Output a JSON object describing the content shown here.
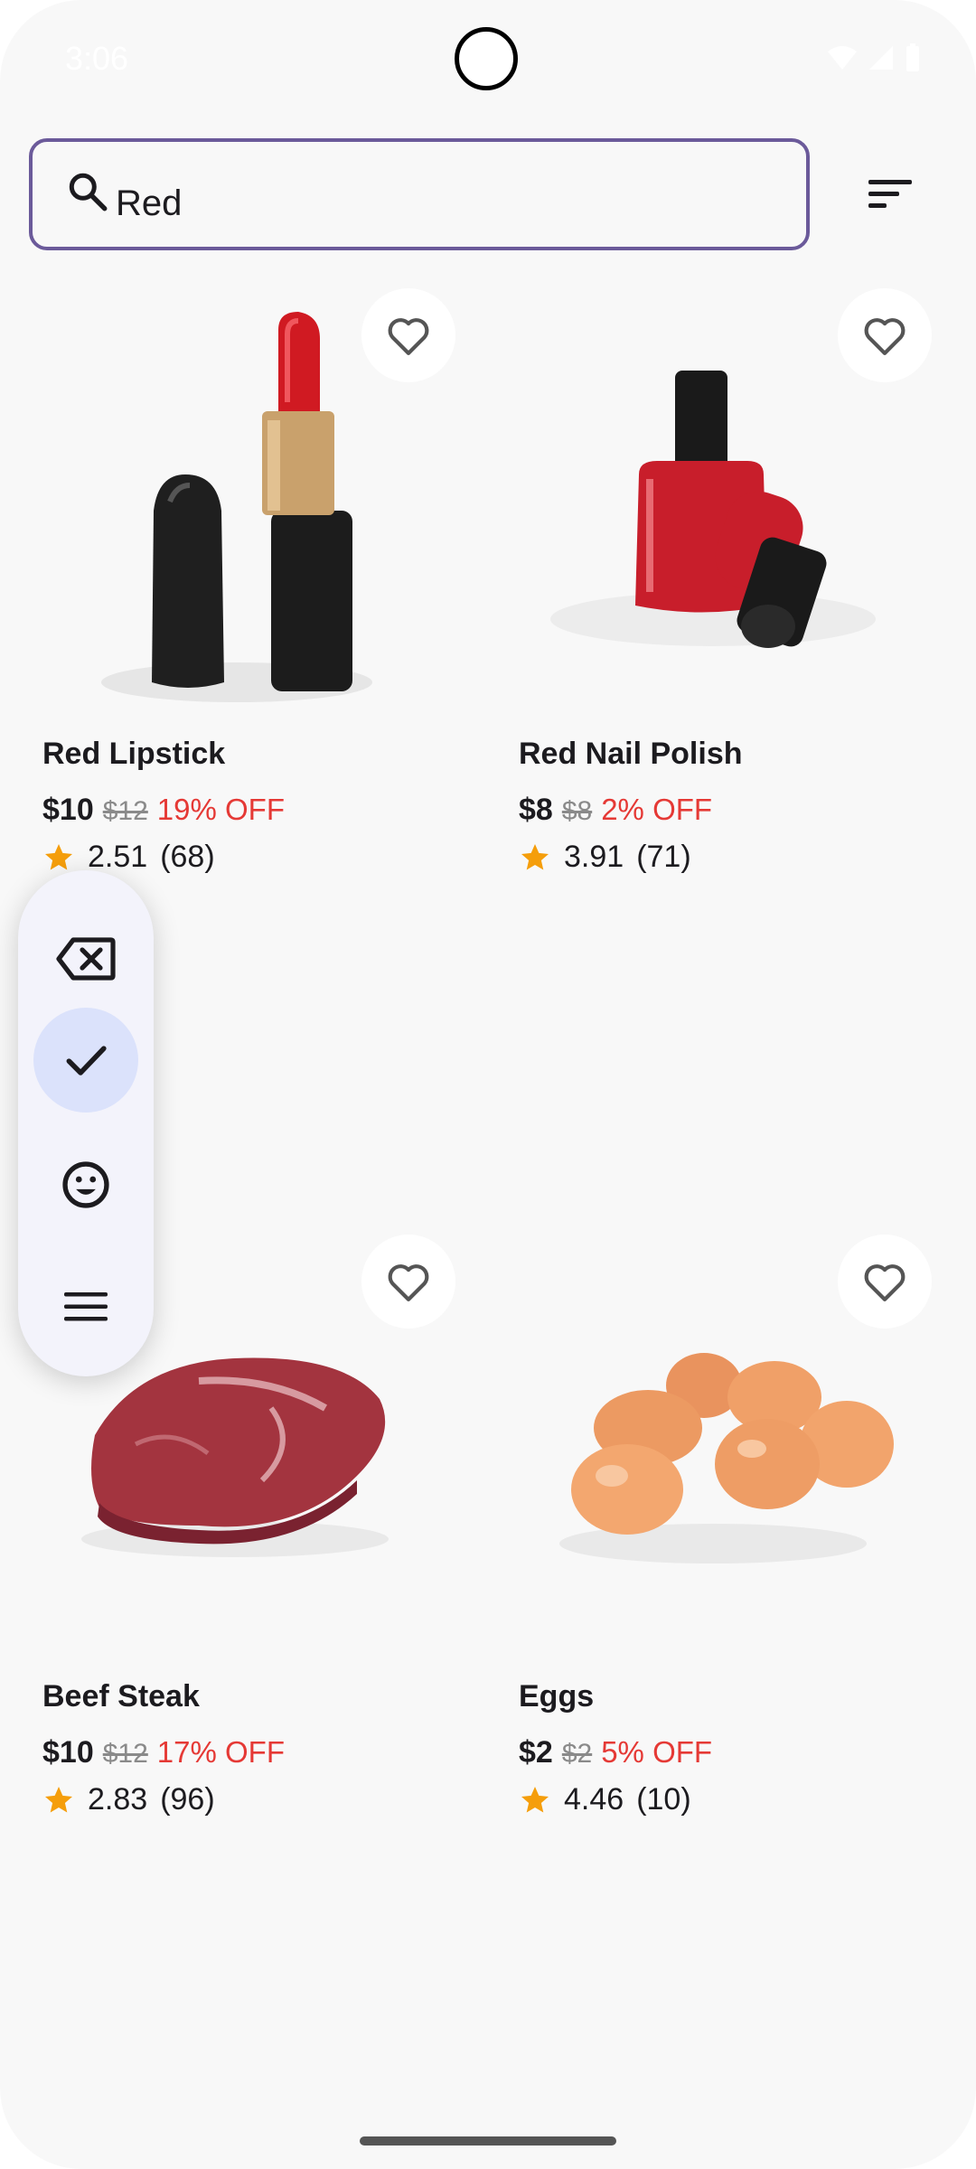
{
  "status_bar": {
    "time": "3:06"
  },
  "search": {
    "value": "Red",
    "placeholder": ""
  },
  "products": [
    {
      "name": "Red Lipstick",
      "price": "$10",
      "old_price": "$12",
      "discount": "19% OFF",
      "rating": "2.51",
      "reviews": "(68)"
    },
    {
      "name": "Red Nail Polish",
      "price": "$8",
      "old_price": "$8",
      "discount": "2% OFF",
      "rating": "3.91",
      "reviews": "(71)"
    },
    {
      "name": "Beef Steak",
      "price": "$10",
      "old_price": "$12",
      "discount": "17% OFF",
      "rating": "2.83",
      "reviews": "(96)"
    },
    {
      "name": "Eggs",
      "price": "$2",
      "old_price": "$2",
      "discount": "5% OFF",
      "rating": "4.46",
      "reviews": "(10)"
    }
  ],
  "toolbar": {
    "icons": [
      "backspace-icon",
      "check-icon",
      "emoji-icon",
      "menu-icon"
    ]
  },
  "colors": {
    "accent": "#6b5a9a",
    "discount": "#e53935",
    "star": "#f59e0b"
  }
}
